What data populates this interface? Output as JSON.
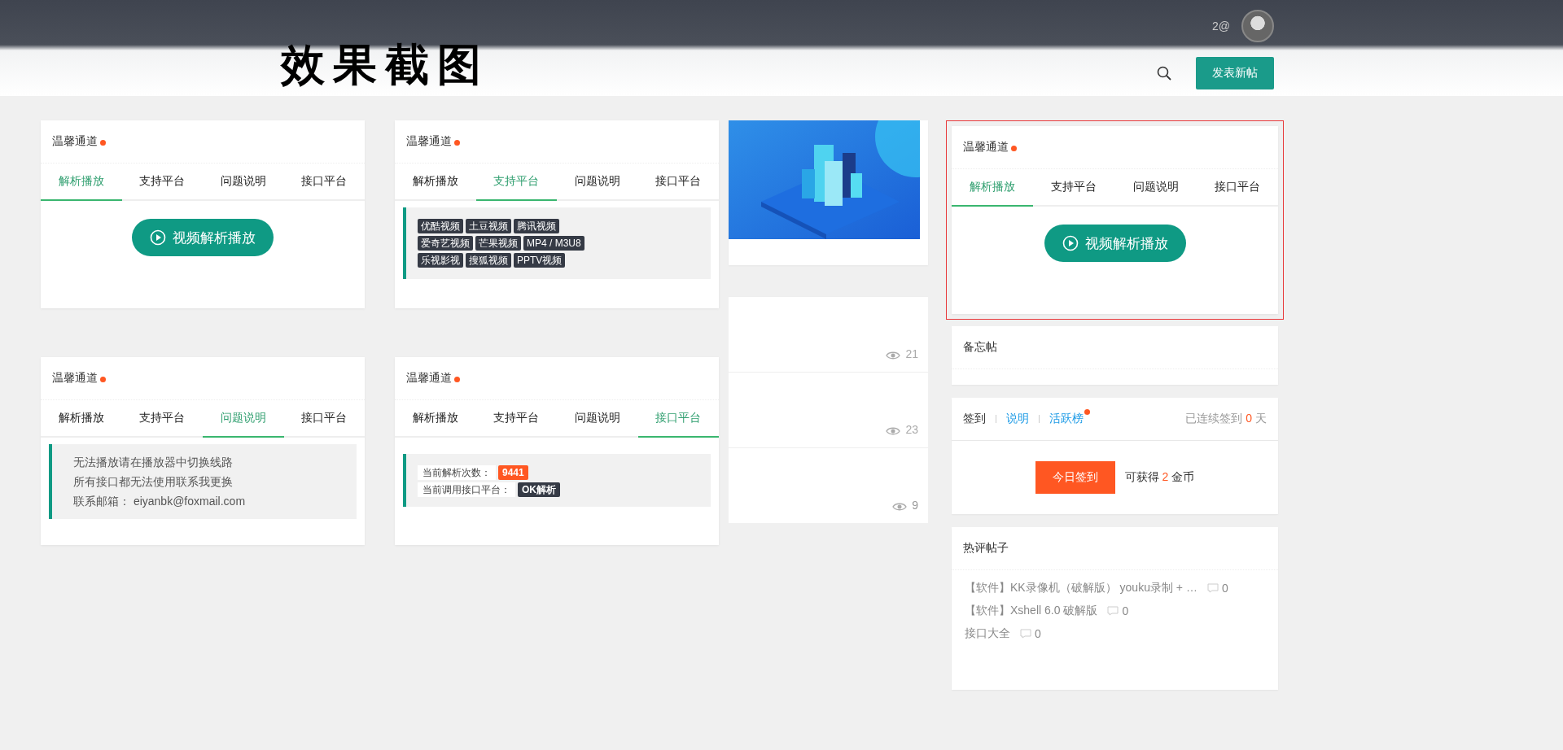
{
  "header": {
    "title": "效果截图",
    "user": "2@",
    "post_button": "发表新帖"
  },
  "widgets": [
    {
      "title": "温馨通道",
      "highlighted": false,
      "tabs": [
        {
          "label": "解析播放",
          "selected": true
        },
        {
          "label": "支持平台",
          "selected": false
        },
        {
          "label": "问题说明",
          "selected": false
        },
        {
          "label": "接口平台",
          "selected": false
        }
      ],
      "panel": {
        "kind": "play",
        "button": "视频解析播放"
      }
    },
    {
      "title": "温馨通道",
      "highlighted": false,
      "tabs": [
        {
          "label": "解析播放",
          "selected": false
        },
        {
          "label": "支持平台",
          "selected": true
        },
        {
          "label": "问题说明",
          "selected": false
        },
        {
          "label": "接口平台",
          "selected": false
        }
      ],
      "panel": {
        "kind": "platforms",
        "rows": [
          [
            "优酷视频",
            "土豆视频",
            "腾讯视频"
          ],
          [
            "爱奇艺视频",
            "芒果视频",
            "MP4 / M3U8"
          ],
          [
            "乐视影视",
            "搜狐视频",
            "PPTV视频"
          ]
        ]
      }
    },
    {
      "title": "温馨通道",
      "highlighted": false,
      "tabs": [
        {
          "label": "解析播放",
          "selected": false
        },
        {
          "label": "支持平台",
          "selected": false
        },
        {
          "label": "问题说明",
          "selected": true
        },
        {
          "label": "接口平台",
          "selected": false
        }
      ],
      "panel": {
        "kind": "notes",
        "lines": [
          "无法播放请在播放器中切换线路",
          "所有接口都无法使用联系我更换",
          "联系邮箱： eiyanbk@foxmail.com"
        ]
      }
    },
    {
      "title": "温馨通道",
      "highlighted": false,
      "tabs": [
        {
          "label": "解析播放",
          "selected": false
        },
        {
          "label": "支持平台",
          "selected": false
        },
        {
          "label": "问题说明",
          "selected": false
        },
        {
          "label": "接口平台",
          "selected": true
        }
      ],
      "panel": {
        "kind": "stats",
        "rows": [
          {
            "label": "当前解析次数：",
            "value": "9441",
            "kind": "count"
          },
          {
            "label": "当前调用接口平台：",
            "value": "OK解析",
            "kind": "name"
          }
        ]
      }
    }
  ],
  "feed": {
    "views": [
      "21",
      "23",
      "9"
    ]
  },
  "sidebar": {
    "widget": {
      "title": "温馨通道",
      "highlighted": true,
      "tabs": [
        {
          "label": "解析播放",
          "selected": true
        },
        {
          "label": "支持平台",
          "selected": false
        },
        {
          "label": "问题说明",
          "selected": false
        },
        {
          "label": "接口平台",
          "selected": false
        }
      ],
      "panel": {
        "kind": "play",
        "button": "视频解析播放"
      }
    },
    "memo": {
      "title": "备忘帖"
    },
    "signin": {
      "links": [
        {
          "label": "签到",
          "selected": true,
          "badge": false
        },
        {
          "label": "说明",
          "selected": false,
          "badge": false
        },
        {
          "label": "活跃榜",
          "selected": false,
          "badge": true
        }
      ],
      "streak": [
        "已连续签到",
        "0",
        "天"
      ],
      "button": "今日签到",
      "reward": [
        "可获得",
        "2",
        "金币"
      ]
    },
    "hot_posts": {
      "title": "热评帖子",
      "items": [
        {
          "title": "【软件】KK录像机（破解版） youku录制 + …",
          "comments": "0"
        },
        {
          "title": "【软件】Xshell 6.0 破解版",
          "comments": "0"
        },
        {
          "title": "接口大全",
          "comments": "0"
        }
      ]
    }
  }
}
